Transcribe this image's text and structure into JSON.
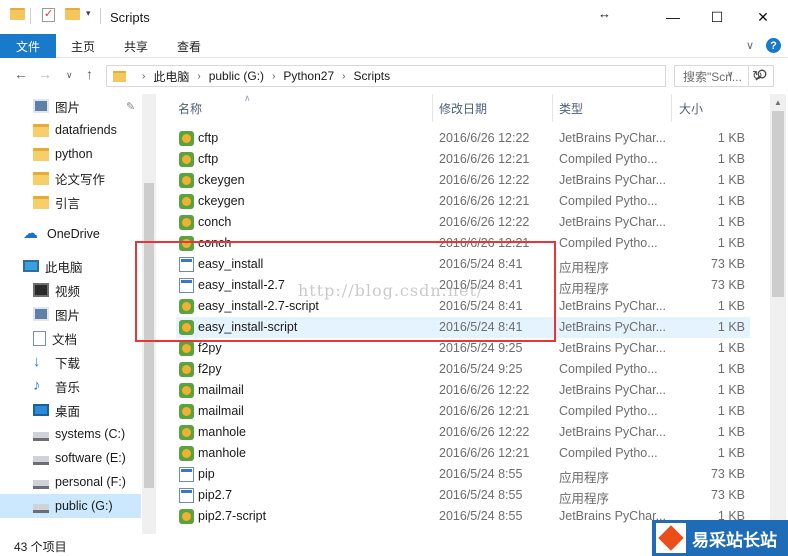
{
  "window": {
    "title": "Scripts",
    "minimize": "—",
    "maximize": "☐",
    "close": "✕",
    "resize_glyph": "↔"
  },
  "ribbon": {
    "file": "文件",
    "home": "主页",
    "share": "共享",
    "view": "查看",
    "expand": "∨",
    "help": "?"
  },
  "nav": {
    "back": "←",
    "forward": "→",
    "history": "∨",
    "up": "↑",
    "refresh": "↻"
  },
  "address": {
    "crumbs": [
      "此电脑",
      "public (G:)",
      "Python27",
      "Scripts"
    ],
    "separator": "›",
    "dropdown": "∨"
  },
  "search": {
    "placeholder": "搜索\"Scri...",
    "icon": "search-icon"
  },
  "sidebar": {
    "items": [
      {
        "label": "图片",
        "icon": "pictures-icon",
        "pinned": true
      },
      {
        "label": "datafriends",
        "icon": "folder-icon"
      },
      {
        "label": "python",
        "icon": "folder-icon"
      },
      {
        "label": "论文写作",
        "icon": "folder-icon"
      },
      {
        "label": "引言",
        "icon": "folder-icon"
      },
      {
        "label": "OneDrive",
        "icon": "cloud-icon"
      },
      {
        "label": "此电脑",
        "icon": "computer-icon"
      },
      {
        "label": "视频",
        "icon": "video-icon"
      },
      {
        "label": "图片",
        "icon": "pictures-icon"
      },
      {
        "label": "文档",
        "icon": "document-icon"
      },
      {
        "label": "下载",
        "icon": "download-icon"
      },
      {
        "label": "音乐",
        "icon": "music-icon"
      },
      {
        "label": "桌面",
        "icon": "desktop-icon"
      },
      {
        "label": "systems (C:)",
        "icon": "drive-icon"
      },
      {
        "label": "software (E:)",
        "icon": "drive-icon"
      },
      {
        "label": "personal (F:)",
        "icon": "drive-icon"
      },
      {
        "label": "public (G:)",
        "icon": "drive-icon",
        "selected": true
      }
    ]
  },
  "columns": {
    "name": "名称",
    "date": "修改日期",
    "type": "类型",
    "size": "大小",
    "sort_indicator": "∧"
  },
  "files": [
    {
      "name": "cftp",
      "date": "2016/6/26 12:22",
      "type": "JetBrains PyChar...",
      "size": "1 KB",
      "icon": "python-file-icon"
    },
    {
      "name": "cftp",
      "date": "2016/6/26 12:21",
      "type": "Compiled Pytho...",
      "size": "1 KB",
      "icon": "python-file-icon"
    },
    {
      "name": "ckeygen",
      "date": "2016/6/26 12:22",
      "type": "JetBrains PyChar...",
      "size": "1 KB",
      "icon": "python-file-icon"
    },
    {
      "name": "ckeygen",
      "date": "2016/6/26 12:21",
      "type": "Compiled Pytho...",
      "size": "1 KB",
      "icon": "python-file-icon"
    },
    {
      "name": "conch",
      "date": "2016/6/26 12:22",
      "type": "JetBrains PyChar...",
      "size": "1 KB",
      "icon": "python-file-icon"
    },
    {
      "name": "conch",
      "date": "2016/6/26 12:21",
      "type": "Compiled Pytho...",
      "size": "1 KB",
      "icon": "python-file-icon"
    },
    {
      "name": "easy_install",
      "date": "2016/5/24 8:41",
      "type": "应用程序",
      "size": "73 KB",
      "icon": "application-icon"
    },
    {
      "name": "easy_install-2.7",
      "date": "2016/5/24 8:41",
      "type": "应用程序",
      "size": "73 KB",
      "icon": "application-icon"
    },
    {
      "name": "easy_install-2.7-script",
      "date": "2016/5/24 8:41",
      "type": "JetBrains PyChar...",
      "size": "1 KB",
      "icon": "python-file-icon"
    },
    {
      "name": "easy_install-script",
      "date": "2016/5/24 8:41",
      "type": "JetBrains PyChar...",
      "size": "1 KB",
      "icon": "python-file-icon",
      "highlighted": true
    },
    {
      "name": "f2py",
      "date": "2016/5/24 9:25",
      "type": "JetBrains PyChar...",
      "size": "1 KB",
      "icon": "python-file-icon"
    },
    {
      "name": "f2py",
      "date": "2016/5/24 9:25",
      "type": "Compiled Pytho...",
      "size": "1 KB",
      "icon": "python-file-icon"
    },
    {
      "name": "mailmail",
      "date": "2016/6/26 12:22",
      "type": "JetBrains PyChar...",
      "size": "1 KB",
      "icon": "python-file-icon"
    },
    {
      "name": "mailmail",
      "date": "2016/6/26 12:21",
      "type": "Compiled Pytho...",
      "size": "1 KB",
      "icon": "python-file-icon"
    },
    {
      "name": "manhole",
      "date": "2016/6/26 12:22",
      "type": "JetBrains PyChar...",
      "size": "1 KB",
      "icon": "python-file-icon"
    },
    {
      "name": "manhole",
      "date": "2016/6/26 12:21",
      "type": "Compiled Pytho...",
      "size": "1 KB",
      "icon": "python-file-icon"
    },
    {
      "name": "pip",
      "date": "2016/5/24 8:55",
      "type": "应用程序",
      "size": "73 KB",
      "icon": "application-icon"
    },
    {
      "name": "pip2.7",
      "date": "2016/5/24 8:55",
      "type": "应用程序",
      "size": "73 KB",
      "icon": "application-icon"
    },
    {
      "name": "pip2.7-script",
      "date": "2016/5/24 8:55",
      "type": "JetBrains PyChar...",
      "size": "1 KB",
      "icon": "python-file-icon"
    }
  ],
  "watermark": "http://blog.csdn.net/",
  "status": {
    "count": "43 个项目"
  },
  "logo": {
    "text": "易采站长站"
  },
  "colors": {
    "accent": "#1979ca",
    "selection": "#cce8ff",
    "annotation": "#e8353a"
  }
}
